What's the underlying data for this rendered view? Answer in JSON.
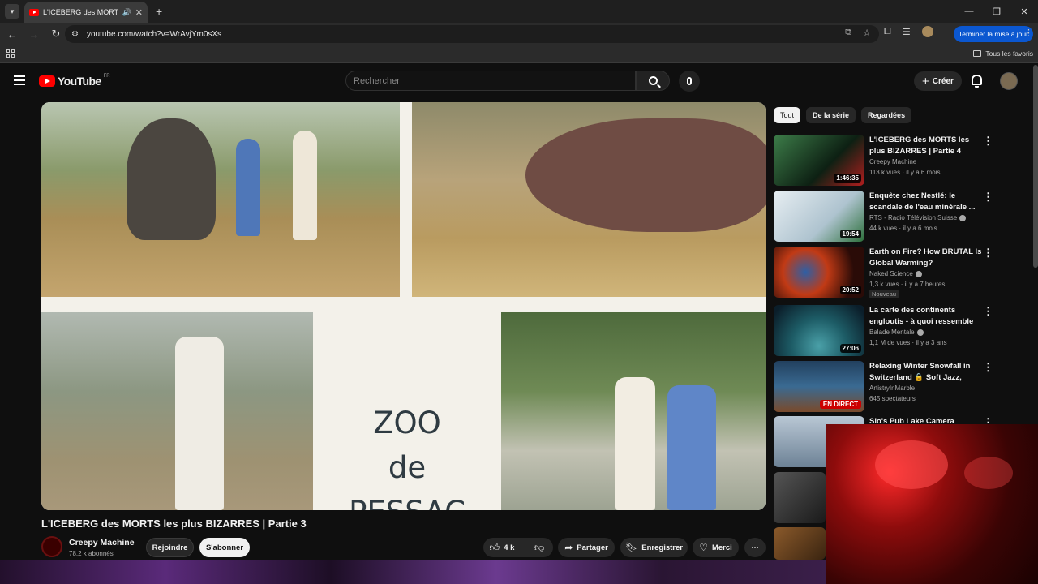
{
  "browser": {
    "tab_title": "L'ICEBERG des MORTS les p",
    "url": "youtube.com/watch?v=WrAvjYm0sXs",
    "update_button": "Terminer la mise à jour",
    "bookmarks_all": "Tous les favoris"
  },
  "header": {
    "logo_text": "YouTube",
    "logo_country": "FR",
    "search_placeholder": "Rechercher",
    "create_label": "Créer"
  },
  "video": {
    "frame_text_line1": "ZOO",
    "frame_text_line2": "de",
    "frame_text_line3": "PESSAC",
    "title": "L'ICEBERG des MORTS les plus BIZARRES | Partie 3",
    "channel": "Creepy Machine",
    "subscribers": "78,2 k abonnés",
    "join_label": "Rejoindre",
    "subscribe_label": "S'abonner",
    "likes": "4 k",
    "share_label": "Partager",
    "save_label": "Enregistrer",
    "thanks_label": "Merci"
  },
  "chips": [
    {
      "label": "Tout",
      "active": true
    },
    {
      "label": "De la série",
      "active": false
    },
    {
      "label": "Regardées",
      "active": false
    }
  ],
  "recommendations": [
    {
      "title": "L'ICEBERG des MORTS les plus BIZARRES | Partie 4",
      "channel": "Creepy Machine",
      "meta": "113 k vues · il y a 6 mois",
      "duration": "1:46:35",
      "thumb_color": "#2c6a3a"
    },
    {
      "title": "Enquête chez Nestlé: le scandale de l'eau minérale ...",
      "channel": "RTS - Radio Télévision Suisse",
      "meta": "44 k vues · il y a 6 mois",
      "duration": "19:54",
      "thumb_color": "#c7d8e2"
    },
    {
      "title": "Earth on Fire? How BRUTAL Is Global Warming?",
      "channel": "Naked Science",
      "meta": "1,3 k vues · il y a 7 heures",
      "badge": "Nouveau",
      "duration": "20:52",
      "thumb_color": "#3a1410"
    },
    {
      "title": "La carte des continents engloutis - à quoi ressemble la...",
      "channel": "Balade Mentale",
      "meta": "1,1 M de vues · il y a 3 ans",
      "duration": "27:06",
      "thumb_color": "#2d6f7a"
    },
    {
      "title": "Relaxing Winter Snowfall in Switzerland 🔒 Soft Jazz, Coz...",
      "channel": "ArtistryInMarble",
      "meta": "645 spectateurs",
      "live": "EN DIRECT",
      "thumb_color": "#1d3550"
    },
    {
      "title": "Slo's Pub Lake Camera",
      "channel": "",
      "meta": "",
      "thumb_color": "#8fa3b8"
    }
  ]
}
